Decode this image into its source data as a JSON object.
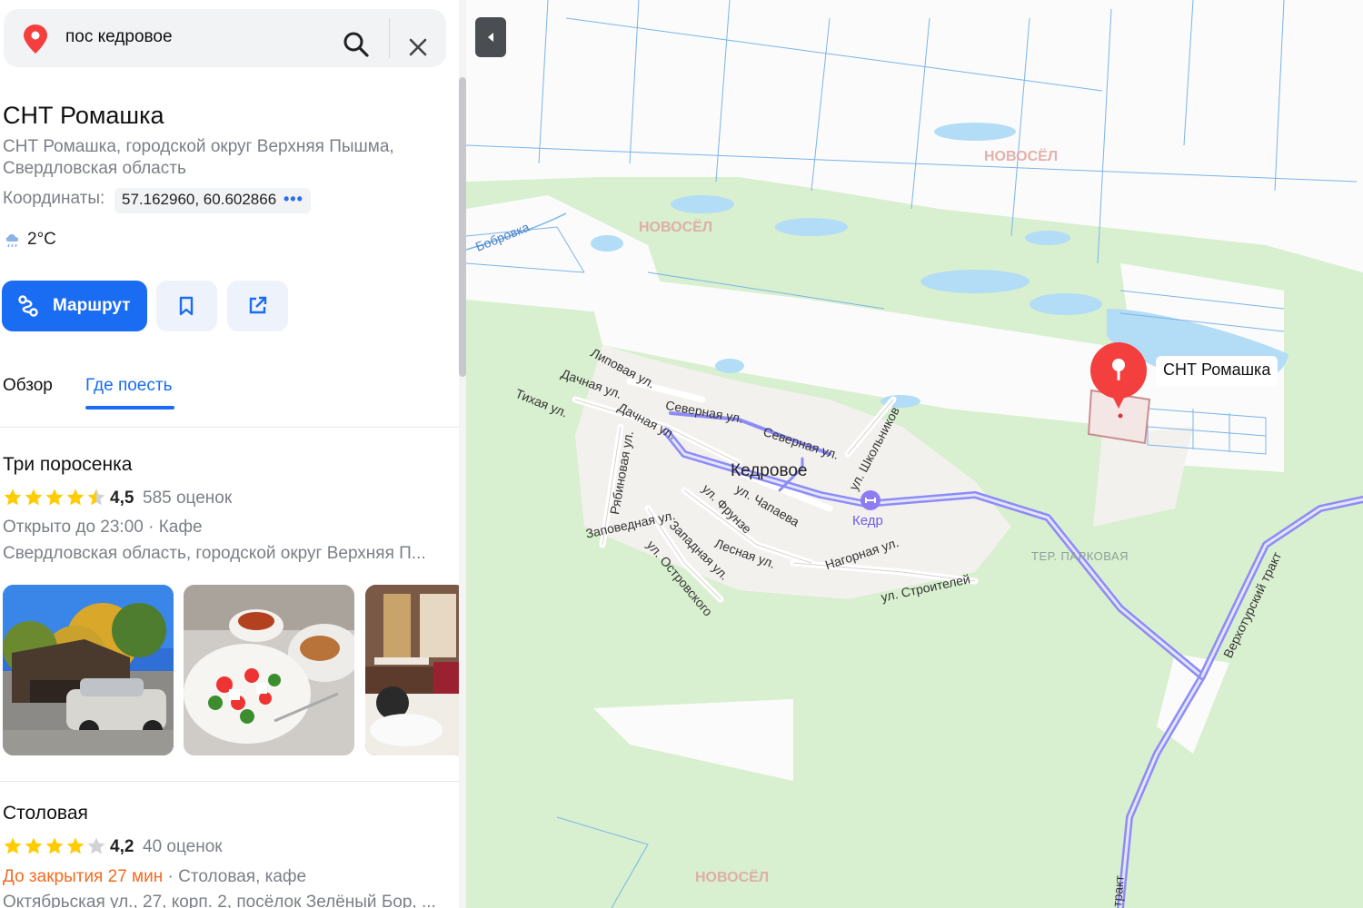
{
  "search": {
    "query": "пос кедровое"
  },
  "place": {
    "title": "СНТ Ромашка",
    "address": "СНТ Ромашка, городской округ Верхняя Пышма, Свердловская область",
    "coords_label": "Координаты:",
    "coords_value": "57.162960, 60.602866",
    "coords_more": "•••",
    "weather": "2°C"
  },
  "actions": {
    "route_label": "Маршрут"
  },
  "tabs": [
    {
      "label": "Обзор"
    },
    {
      "label": "Где поесть"
    }
  ],
  "results": [
    {
      "name": "Три поросенка",
      "rating": "4,5",
      "rating_value": 4.5,
      "reviews": "585 оценок",
      "hours": "Открыто до 23:00",
      "category": "Кафе",
      "address": "Свердловская область, городской округ Верхняя П..."
    },
    {
      "name": "Столовая",
      "rating": "4,2",
      "rating_value": 4.2,
      "reviews": "40 оценок",
      "hours": "До закрытия 27 мин",
      "category": "Столовая, кафе",
      "address": "Октябрьская ул., 27, корп. 2, посёлок Зелёный Бор, ..."
    }
  ],
  "map": {
    "settlement": "Кедровое",
    "poi_kedr": "Кедр",
    "territory": "ТЕР. ПАРКОВАЯ",
    "marker_label": "СНТ Ромашка",
    "river": "Бобровка",
    "watermark": "НОВОСЁЛ",
    "streets": [
      "Липовая ул.",
      "Дачная ул.",
      "Тихая ул.",
      "Дачная ул.",
      "Северная ул.",
      "Северная ул.",
      "ул. Школьников",
      "Рябиновая ул.",
      "ул. Чапаева",
      "ул. Фрунзе",
      "Заповедная ул.",
      "Западная ул.",
      "Лесная ул.",
      "Нагорная ул.",
      "ул. Островского",
      "ул. Строителей",
      "Верхотурский тракт",
      "тракт"
    ]
  },
  "colors": {
    "accent": "#1a6cf2",
    "closing": "#f56a1f",
    "marker": "#f43f3f",
    "forest": "#d8f0cf"
  }
}
